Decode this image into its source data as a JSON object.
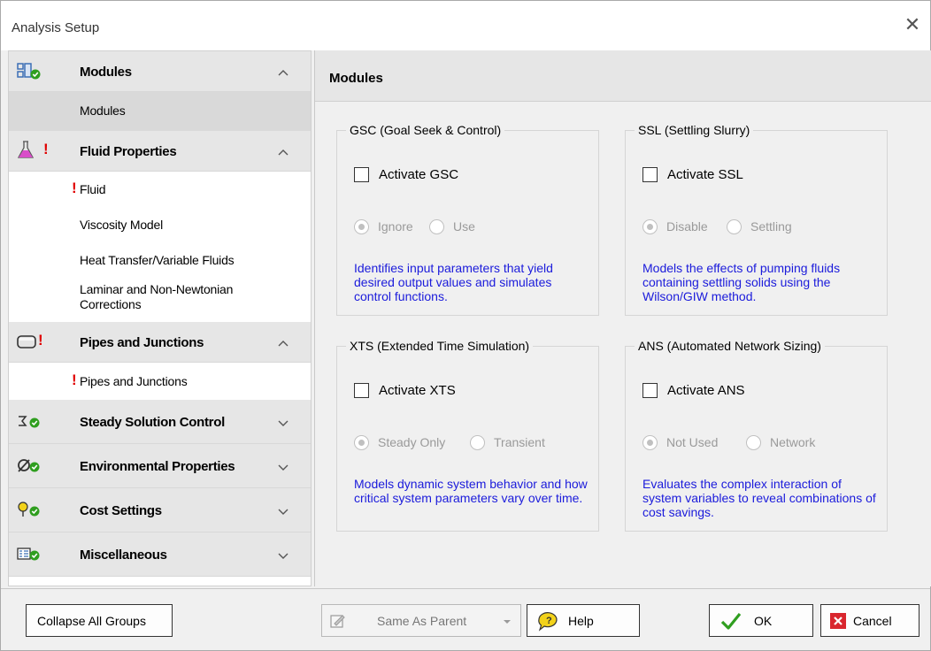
{
  "window": {
    "title": "Analysis Setup",
    "close_glyph": "✕"
  },
  "sidebar": {
    "groups": [
      {
        "label": "Modules",
        "expanded": true,
        "icon": "modules-icon",
        "items": [
          {
            "label": "Modules",
            "selected": true
          }
        ]
      },
      {
        "label": "Fluid Properties",
        "expanded": true,
        "icon": "flask-icon",
        "warning": "!",
        "items": [
          {
            "label": "Fluid",
            "warning": "!"
          },
          {
            "label": "Viscosity Model"
          },
          {
            "label": "Heat Transfer/Variable Fluids"
          },
          {
            "label": "Laminar and Non-Newtonian Corrections"
          }
        ]
      },
      {
        "label": "Pipes and Junctions",
        "expanded": true,
        "icon": "pipe-icon",
        "warning": "!",
        "items": [
          {
            "label": "Pipes and Junctions",
            "warning": "!"
          }
        ]
      },
      {
        "label": "Steady Solution Control",
        "expanded": false,
        "icon": "solution-icon"
      },
      {
        "label": "Environmental Properties",
        "expanded": false,
        "icon": "environment-icon"
      },
      {
        "label": "Cost Settings",
        "expanded": false,
        "icon": "cost-icon"
      },
      {
        "label": "Miscellaneous",
        "expanded": false,
        "icon": "misc-icon"
      }
    ]
  },
  "main": {
    "title": "Modules",
    "modules": [
      {
        "legend": "GSC (Goal Seek & Control)",
        "checkbox": "Activate GSC",
        "radios": [
          "Ignore",
          "Use"
        ],
        "desc": "Identifies input parameters that yield desired output values and simulates control functions."
      },
      {
        "legend": "SSL (Settling Slurry)",
        "checkbox": "Activate SSL",
        "radios": [
          "Disable",
          "Settling"
        ],
        "desc": "Models the effects of pumping fluids containing settling solids using the Wilson/GIW method."
      },
      {
        "legend": "XTS (Extended Time Simulation)",
        "checkbox": "Activate XTS",
        "radios": [
          "Steady Only",
          "Transient"
        ],
        "desc": "Models dynamic system behavior and how critical system parameters vary over time."
      },
      {
        "legend": "ANS (Automated Network Sizing)",
        "checkbox": "Activate ANS",
        "radios": [
          "Not Used",
          "Network"
        ],
        "desc": "Evaluates the complex interaction of system variables to reveal combinations of cost savings."
      }
    ]
  },
  "footer": {
    "collapse_label": "Collapse All Groups",
    "parent_label": "Same As Parent",
    "help_label": "Help",
    "ok_label": "OK",
    "cancel_label": "Cancel"
  },
  "colors": {
    "link_blue": "#1b1bdb",
    "ok_green": "#2f9e1f",
    "cancel_red": "#d9262e",
    "warning_red": "#e00000"
  }
}
